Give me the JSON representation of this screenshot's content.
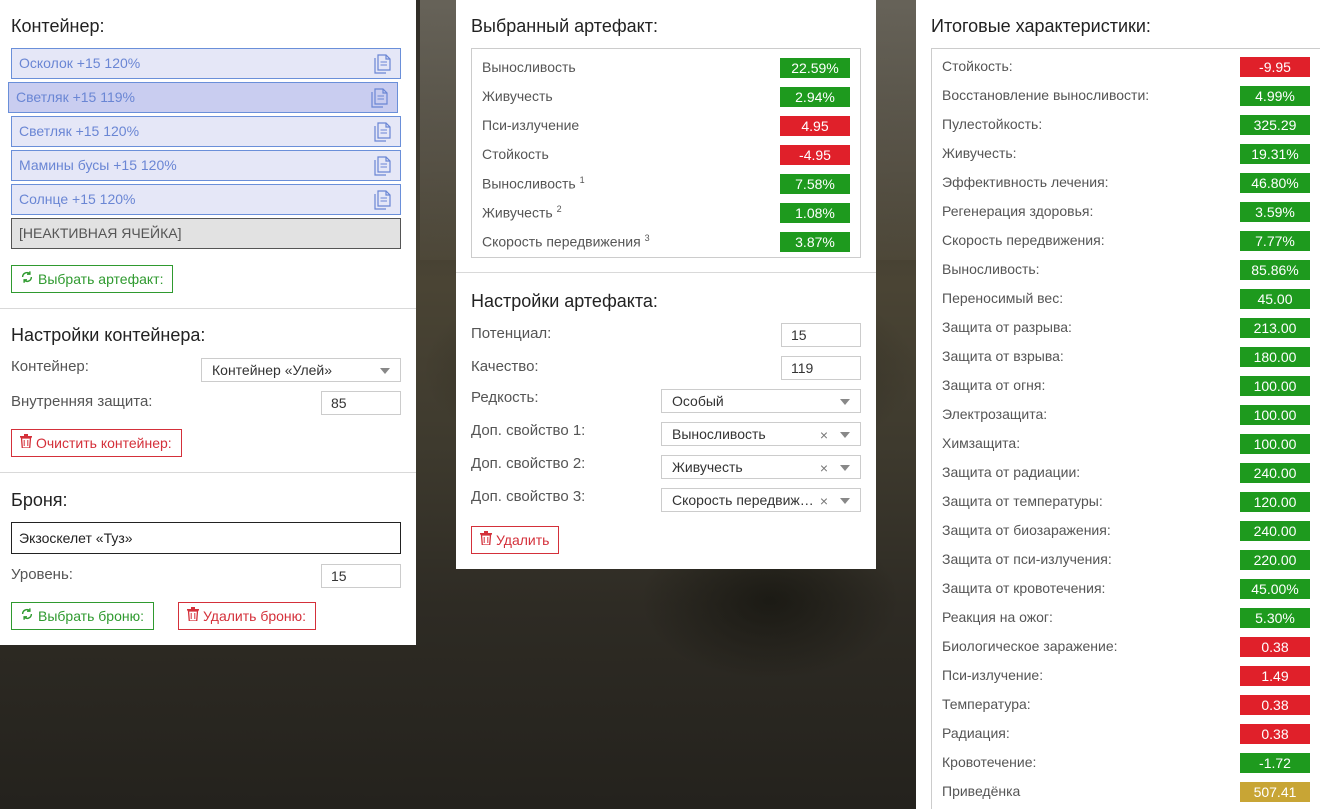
{
  "container_section": {
    "title": "Контейнер:",
    "slots": [
      {
        "label": "Осколок +15 120%"
      },
      {
        "label": "Светляк +15 119%"
      },
      {
        "label": "Светляк +15 120%"
      },
      {
        "label": "Мамины бусы +15 120%"
      },
      {
        "label": "Солнце +15 120%"
      }
    ],
    "inactive_slot": "[НЕАКТИВНАЯ ЯЧЕЙКА]",
    "select_artifact_button": "Выбрать артефакт:"
  },
  "container_settings": {
    "title": "Настройки контейнера:",
    "container_label": "Контейнер:",
    "container_value": "Контейнер «Улей»",
    "inner_protection_label": "Внутренняя защита:",
    "inner_protection_value": "85",
    "clear_button": "Очистить контейнер:"
  },
  "armor_section": {
    "title": "Броня:",
    "armor_name": "Экзоскелет «Туз»",
    "level_label": "Уровень:",
    "level_value": "15",
    "select_button": "Выбрать броню:",
    "delete_button": "Удалить броню:"
  },
  "selected_artifact": {
    "title": "Выбранный артефакт:",
    "stats": [
      {
        "name": "Выносливость",
        "sup": "",
        "value": "22.59%",
        "status": "good"
      },
      {
        "name": "Живучесть",
        "sup": "",
        "value": "2.94%",
        "status": "good"
      },
      {
        "name": "Пси-излучение",
        "sup": "",
        "value": "4.95",
        "status": "bad"
      },
      {
        "name": "Стойкость",
        "sup": "",
        "value": "-4.95",
        "status": "bad"
      },
      {
        "name": "Выносливость",
        "sup": "1",
        "value": "7.58%",
        "status": "good"
      },
      {
        "name": "Живучесть",
        "sup": "2",
        "value": "1.08%",
        "status": "good"
      },
      {
        "name": "Скорость передвижения",
        "sup": "3",
        "value": "3.87%",
        "status": "good"
      }
    ]
  },
  "artifact_settings": {
    "title": "Настройки артефакта:",
    "potential_label": "Потенциал:",
    "potential_value": "15",
    "quality_label": "Качество:",
    "quality_value": "119",
    "rarity_label": "Редкость:",
    "rarity_value": "Особый",
    "extra1_label": "Доп. свойство 1:",
    "extra1_value": "Выносливость",
    "extra2_label": "Доп. свойство 2:",
    "extra2_value": "Живучесть",
    "extra3_label": "Доп. свойство 3:",
    "extra3_value": "Скорость передвижения",
    "delete_button": "Удалить"
  },
  "final_stats": {
    "title": "Итоговые характеристики:",
    "stats": [
      {
        "name": "Стойкость:",
        "value": "-9.95",
        "status": "bad"
      },
      {
        "name": "Восстановление выносливости:",
        "value": "4.99%",
        "status": "good"
      },
      {
        "name": "Пулестойкость:",
        "value": "325.29",
        "status": "good"
      },
      {
        "name": "Живучесть:",
        "value": "19.31%",
        "status": "good"
      },
      {
        "name": "Эффективность лечения:",
        "value": "46.80%",
        "status": "good"
      },
      {
        "name": "Регенерация здоровья:",
        "value": "3.59%",
        "status": "good"
      },
      {
        "name": "Скорость передвижения:",
        "value": "7.77%",
        "status": "good"
      },
      {
        "name": "Выносливость:",
        "value": "85.86%",
        "status": "good"
      },
      {
        "name": "Переносимый вес:",
        "value": "45.00",
        "status": "good"
      },
      {
        "name": "Защита от разрыва:",
        "value": "213.00",
        "status": "good"
      },
      {
        "name": "Защита от взрыва:",
        "value": "180.00",
        "status": "good"
      },
      {
        "name": "Защита от огня:",
        "value": "100.00",
        "status": "good"
      },
      {
        "name": "Электрозащита:",
        "value": "100.00",
        "status": "good"
      },
      {
        "name": "Химзащита:",
        "value": "100.00",
        "status": "good"
      },
      {
        "name": "Защита от радиации:",
        "value": "240.00",
        "status": "good"
      },
      {
        "name": "Защита от температуры:",
        "value": "120.00",
        "status": "good"
      },
      {
        "name": "Защита от биозаражения:",
        "value": "240.00",
        "status": "good"
      },
      {
        "name": "Защита от пси-излучения:",
        "value": "220.00",
        "status": "good"
      },
      {
        "name": "Защита от кровотечения:",
        "value": "45.00%",
        "status": "good"
      },
      {
        "name": "Реакция на ожог:",
        "value": "5.30%",
        "status": "good"
      },
      {
        "name": "Биологическое заражение:",
        "value": "0.38",
        "status": "bad"
      },
      {
        "name": "Пси-излучение:",
        "value": "1.49",
        "status": "bad"
      },
      {
        "name": "Температура:",
        "value": "0.38",
        "status": "bad"
      },
      {
        "name": "Радиация:",
        "value": "0.38",
        "status": "bad"
      },
      {
        "name": "Кровотечение:",
        "value": "-1.72",
        "status": "good"
      },
      {
        "name": "Приведёнка",
        "value": "507.41",
        "status": "neutral"
      }
    ]
  },
  "colors": {
    "good": "#1e9a1e",
    "bad": "#e0202a",
    "neutral": "#c8a535",
    "slot_border": "#6a8fd9"
  }
}
